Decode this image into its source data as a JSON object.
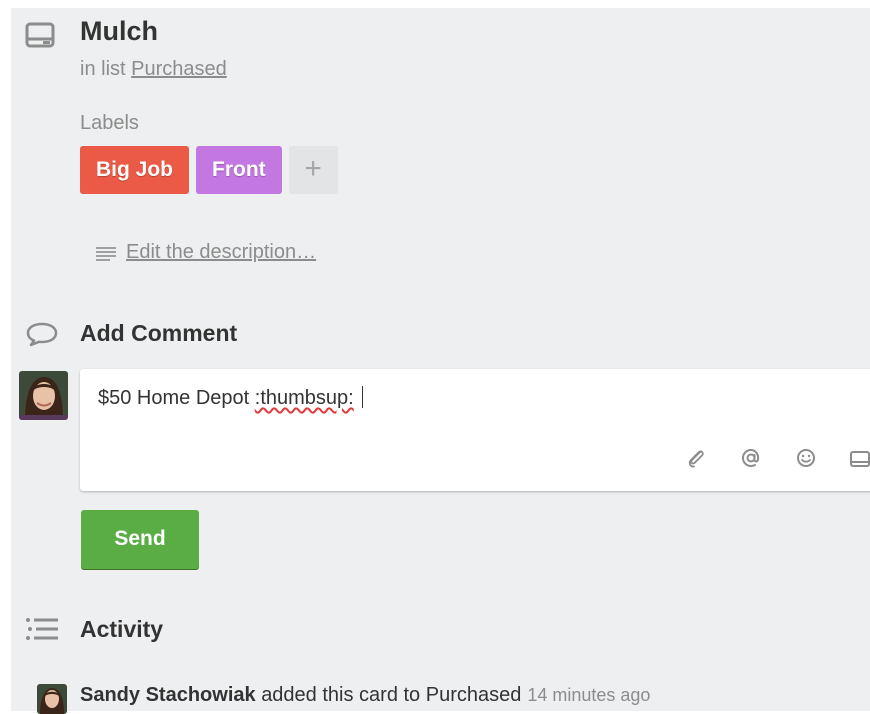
{
  "card": {
    "title": "Mulch",
    "in_list_prefix": "in list",
    "list_name": "Purchased"
  },
  "labels": {
    "heading": "Labels",
    "items": [
      {
        "text": "Big Job",
        "color": "#eb5a46"
      },
      {
        "text": "Front",
        "color": "#c377e0"
      }
    ],
    "add_symbol": "+"
  },
  "description": {
    "link": "Edit the description…"
  },
  "comment": {
    "heading": "Add Comment",
    "text_before": "$50 Home Depot ",
    "text_misspelled": ":thumbsup:",
    "tools": [
      "paperclip-icon",
      "mention-icon",
      "emoji-icon",
      "card-icon"
    ],
    "send_label": "Send"
  },
  "activity": {
    "heading": "Activity",
    "entry": {
      "user": "Sandy Stachowiak",
      "action": "added this card to Purchased",
      "time": "14 minutes ago"
    }
  },
  "colors": {
    "panel_bg": "#edeff0",
    "send_green": "#5aac44",
    "muted_text": "#8c8c8c"
  }
}
